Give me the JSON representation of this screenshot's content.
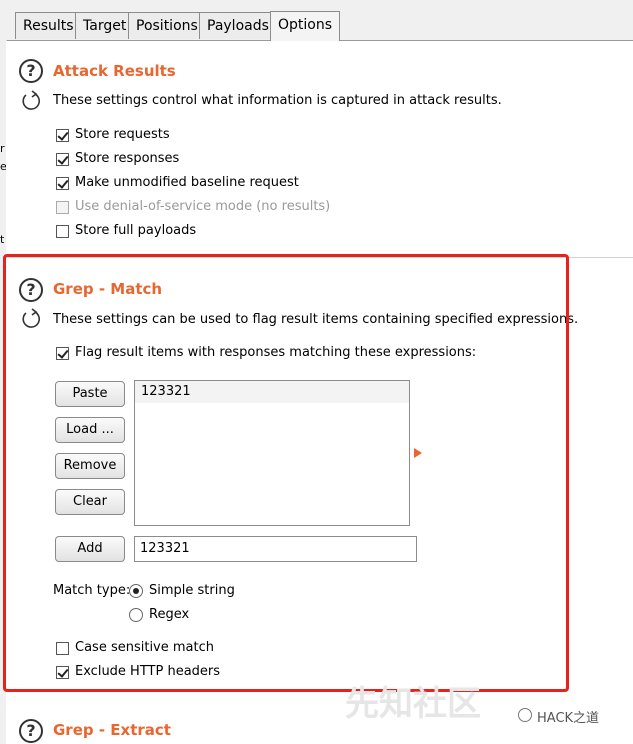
{
  "tabs": [
    "Results",
    "Target",
    "Positions",
    "Payloads",
    "Options"
  ],
  "active_tab": "Options",
  "gutter_glyphs": [
    "r",
    "e",
    "t"
  ],
  "attack_results": {
    "title": "Attack Results",
    "description": "These settings control what information is captured in attack results.",
    "options": [
      {
        "label": "Store requests",
        "checked": true,
        "disabled": false
      },
      {
        "label": "Store responses",
        "checked": true,
        "disabled": false
      },
      {
        "label": "Make unmodified baseline request",
        "checked": true,
        "disabled": false
      },
      {
        "label": "Use denial-of-service mode (no results)",
        "checked": false,
        "disabled": true
      },
      {
        "label": "Store full payloads",
        "checked": false,
        "disabled": false
      }
    ]
  },
  "grep_match": {
    "title": "Grep - Match",
    "description": "These settings can be used to flag result items containing specified expressions.",
    "flag_label": "Flag result items with responses matching these expressions:",
    "flag_checked": true,
    "buttons": {
      "paste": "Paste",
      "load": "Load ...",
      "remove": "Remove",
      "clear": "Clear",
      "add": "Add"
    },
    "list_items": [
      "123321"
    ],
    "add_input_value": "123321",
    "match_type_label": "Match type:",
    "match_types": [
      {
        "label": "Simple string",
        "checked": true
      },
      {
        "label": "Regex",
        "checked": false
      }
    ],
    "case_sensitive": {
      "label": "Case sensitive match",
      "checked": false
    },
    "exclude_headers": {
      "label": "Exclude HTTP headers",
      "checked": true
    }
  },
  "grep_extract": {
    "title": "Grep - Extract"
  },
  "watermark": {
    "text": "先知社区",
    "brand": "HACK之道"
  },
  "colors": {
    "accent": "#e8662f",
    "highlight_frame": "#e8211a"
  }
}
